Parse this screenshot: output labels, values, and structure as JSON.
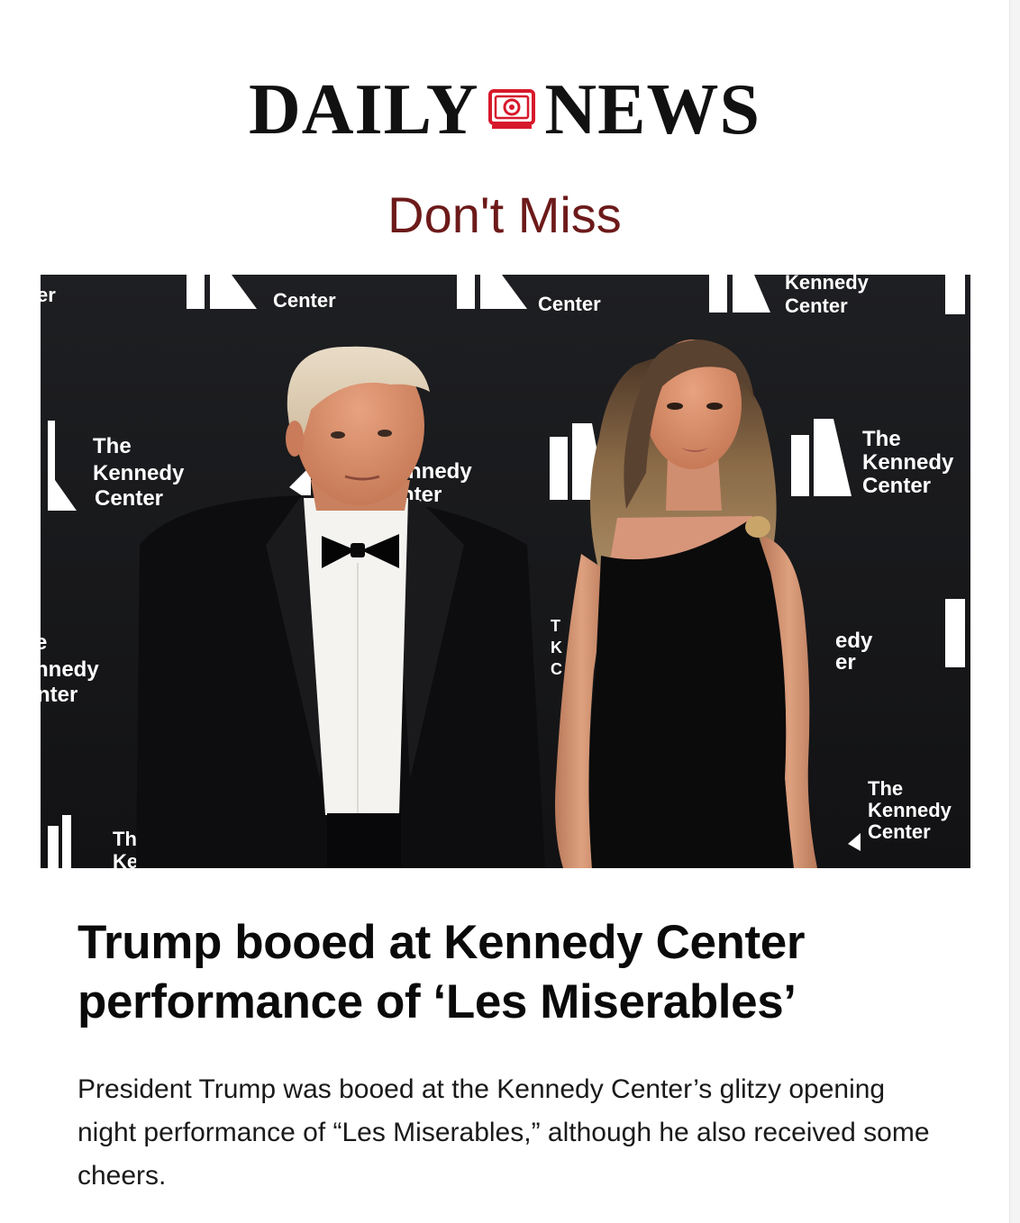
{
  "masthead": {
    "word_left": "DAILY",
    "word_right": "NEWS",
    "logo_icon": "camera-icon",
    "accent_color": "#d7192b"
  },
  "section": {
    "title": "Don't Miss",
    "color": "#6d1a1a"
  },
  "article": {
    "image_alt": "Donald and Melania Trump at the Kennedy Center",
    "headline": "Trump booed at Kennedy Center performance of ‘Les Miserables’",
    "summary": "President Trump was booed at the Kennedy Center’s glitzy opening night performance of “Les Miserables,” although he also received some cheers."
  },
  "backdrop": {
    "line_the": "The",
    "line_kennedy": "Kennedy",
    "line_center": "Center",
    "fragments": {
      "er": "er",
      "nnedy": "nnedy",
      "nter": "nter",
      "edy": "edy",
      "th": "Th",
      "ke": "Ke",
      "e": "e",
      "t": "T",
      "k": "K",
      "c": "C"
    }
  }
}
